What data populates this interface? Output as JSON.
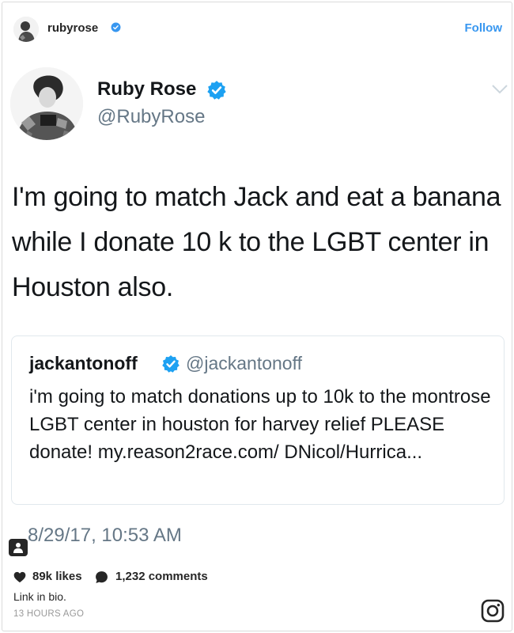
{
  "instagram": {
    "username": "rubyrose",
    "follow_label": "Follow",
    "likes": "89k likes",
    "comments": "1,232 comments",
    "caption": "Link in bio.",
    "time_ago": "13 HOURS AGO",
    "link_color": "#3897f0",
    "verified_color": "#3897f0"
  },
  "tweet": {
    "display_name": "Ruby Rose",
    "handle": "@RubyRose",
    "text": "I'm going to match Jack and eat a banana while I donate 10 k to the LGBT center in Houston also.",
    "timestamp": "8/29/17, 10:53 AM",
    "verified_color": "#1da1f2",
    "quoted": {
      "display_name": "jackantonoff",
      "handle": "@jackantonoff",
      "text": "i'm going to match donations up to 10k to the montrose LGBT center in houston for harvey relief PLEASE donate! my.reason2race.com/ DNicol/Hurrica..."
    }
  },
  "icons": [
    "verified-badge-icon",
    "chevron-down-icon",
    "user-tag-icon",
    "heart-icon",
    "comment-icon",
    "instagram-logo-icon"
  ]
}
